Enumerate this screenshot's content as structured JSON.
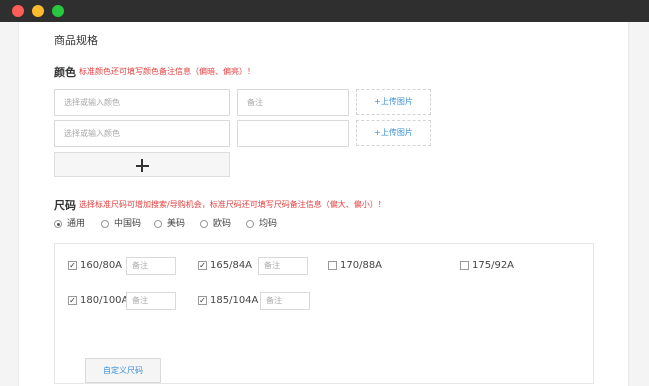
{
  "window": {
    "controls": [
      "close",
      "minimize",
      "maximize"
    ]
  },
  "page": {
    "title": "商品规格"
  },
  "color_section": {
    "title": "颜色",
    "hint": "标准颜色还可填写颜色备注信息（偏暗、偏亮）！",
    "rows": [
      {
        "color_placeholder": "选择或输入颜色",
        "note_value": "备注",
        "upload_label": "+上传图片"
      },
      {
        "color_placeholder": "选择或输入颜色",
        "note_value": "",
        "upload_label": "+上传图片"
      }
    ],
    "add_icon": "plus-icon"
  },
  "size_section": {
    "title": "尺码",
    "hint": "选择标准尺码可增加搜索/导购机会，标准尺码还可填写尺码备注信息（偏大、偏小）！",
    "standards": [
      {
        "label": "通用",
        "selected": true
      },
      {
        "label": "中国码",
        "selected": false
      },
      {
        "label": "美码",
        "selected": false
      },
      {
        "label": "欧码",
        "selected": false
      },
      {
        "label": "均码",
        "selected": false
      }
    ],
    "sizes": [
      {
        "label": "160/80A",
        "checked": true,
        "note_placeholder": "备注"
      },
      {
        "label": "165/84A",
        "checked": true,
        "note_placeholder": "备注"
      },
      {
        "label": "170/88A",
        "checked": false
      },
      {
        "label": "175/92A",
        "checked": false
      },
      {
        "label": "180/100A",
        "checked": true,
        "note_placeholder": "备注"
      },
      {
        "label": "185/104A",
        "checked": true,
        "note_placeholder": "备注"
      }
    ],
    "custom_button": "自定义尺码"
  }
}
